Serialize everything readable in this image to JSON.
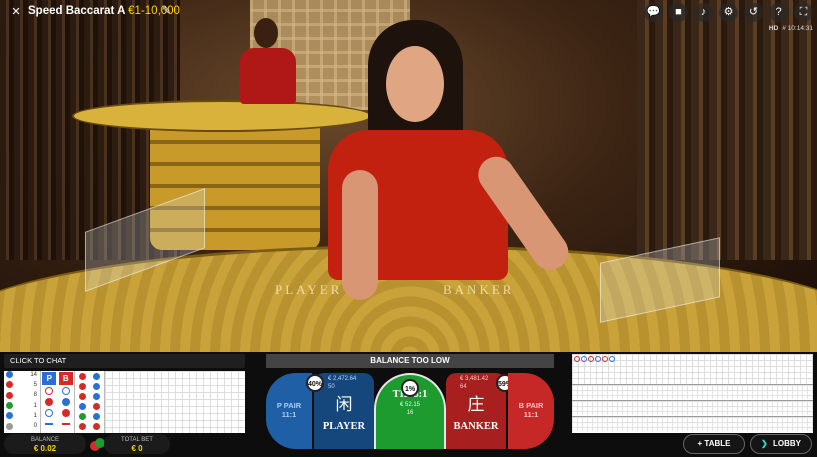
{
  "header": {
    "close_icon": "×",
    "title": "Speed Baccarat A",
    "limits": "€1-10,000",
    "pin_icon": "✎",
    "quality": "HD",
    "time": "# 10:14:31",
    "icons": [
      "chat-icon",
      "video-icon",
      "sound-icon",
      "settings-icon",
      "history-icon",
      "help-icon",
      "fullscreen-icon"
    ]
  },
  "table": {
    "player_label": "PLAYER",
    "banker_label": "BANKER"
  },
  "chat": {
    "label": "CLICK TO CHAT"
  },
  "banner": {
    "text": "BALANCE TOO LOW"
  },
  "stats": {
    "values": [
      "14",
      "5",
      "8",
      "1",
      "1",
      "0"
    ]
  },
  "road_headers": {
    "player": "P",
    "banker": "B"
  },
  "bets": {
    "player_pair": {
      "label": "P PAIR",
      "odds": "11:1"
    },
    "player": {
      "chinese": "闲",
      "label": "PLAYER",
      "percent": "40%",
      "amount": "€ 2,472.64",
      "players": "50"
    },
    "tie": {
      "label": "TIE 8:1",
      "percent": "1%",
      "amount": "€ 52.15",
      "players": "16"
    },
    "banker": {
      "chinese": "庄",
      "label": "BANKER",
      "percent": "59%",
      "amount": "€ 3,481.42",
      "players": "64"
    },
    "banker_pair": {
      "label": "B PAIR",
      "odds": "11:1"
    }
  },
  "balance": {
    "label": "BALANCE",
    "value": "€ 0.02"
  },
  "total_bet": {
    "label": "TOTAL BET",
    "value": "€ 0"
  },
  "buttons": {
    "table": "TABLE",
    "table_icon": "+",
    "lobby": "LOBBY",
    "lobby_icon": "❯"
  },
  "colors": {
    "player": "#1f5fa6",
    "banker": "#c62727",
    "tie": "#1d9b2e",
    "accent": "#ffd400"
  }
}
